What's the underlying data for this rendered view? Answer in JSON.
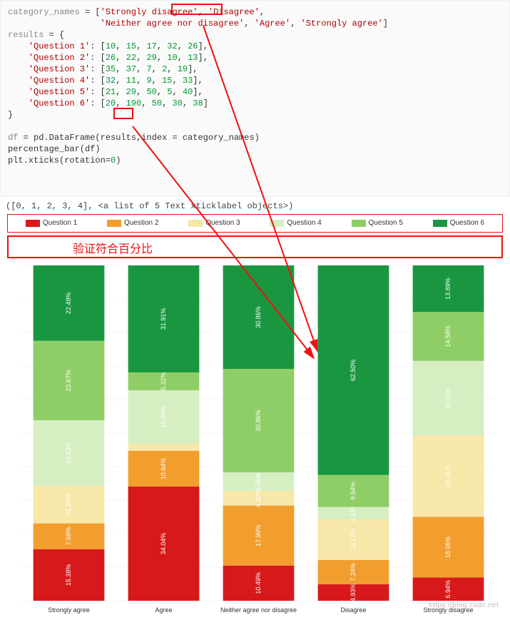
{
  "code": {
    "src": "category_names = ['Strongly disagree', 'Disagree',\n                  'Neither agree nor disagree', 'Agree', 'Strongly agree']\nresults = {\n    'Question 1': [10, 15, 17, 32, 26],\n    'Question 2': [26, 22, 29, 10, 13],\n    'Question 3': [35, 37, 7, 2, 19],\n    'Question 4': [32, 11, 9, 15, 33],\n    'Question 5': [21, 29, 50, 5, 40],\n    'Question 6': [20, 190, 50, 30, 38]\n}\n\ndf = pd.DataFrame(results,index = category_names)\npercentage_bar(df)\nplt.xticks(rotation=0)"
  },
  "output": {
    "text": "([0, 1, 2, 3, 4], <a list of 5 Text xticklabel objects>)"
  },
  "highlight": {
    "value": "190",
    "category": "'Disagree'"
  },
  "annotation": {
    "label": "验证符合百分比"
  },
  "legend": {
    "items": [
      {
        "label": "Question 1",
        "color": "#d7191c"
      },
      {
        "label": "Question 2",
        "color": "#f29e2e"
      },
      {
        "label": "Question 3",
        "color": "#f7e7a8"
      },
      {
        "label": "Question 4",
        "color": "#d6efc2"
      },
      {
        "label": "Question 5",
        "color": "#8fce66"
      },
      {
        "label": "Question 6",
        "color": "#1a9641"
      }
    ]
  },
  "chart_data": {
    "type": "bar",
    "stack": "percent",
    "categories": [
      "Strongly agree",
      "Agree",
      "Neither agree nor disagree",
      "Disagree",
      "Strongly disagree"
    ],
    "series": [
      {
        "name": "Question 1",
        "color": "#d7191c",
        "values": [
          15.38,
          34.04,
          10.49,
          4.93,
          6.94
        ]
      },
      {
        "name": "Question 2",
        "color": "#f29e2e",
        "values": [
          7.69,
          10.64,
          17.9,
          7.24,
          18.06
        ]
      },
      {
        "name": "Question 3",
        "color": "#f7e7a8",
        "values": [
          11.24,
          2.13,
          4.32,
          12.17,
          24.31
        ]
      },
      {
        "name": "Question 4",
        "color": "#d6efc2",
        "values": [
          19.53,
          15.96,
          5.56,
          3.62,
          22.22
        ]
      },
      {
        "name": "Question 5",
        "color": "#8fce66",
        "values": [
          23.67,
          5.32,
          30.86,
          9.54,
          14.58
        ]
      },
      {
        "name": "Question 6",
        "color": "#1a9641",
        "values": [
          22.49,
          31.91,
          30.86,
          62.5,
          13.89
        ]
      }
    ],
    "ylim": [
      0,
      100
    ],
    "title": "",
    "ylabel": "",
    "grid": true
  },
  "watermark": "https://blog.csdn.net"
}
